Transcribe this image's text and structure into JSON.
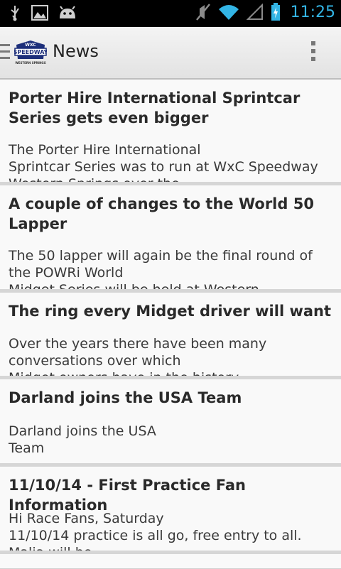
{
  "status_bar": {
    "time": "11:25",
    "icons": [
      "usb-icon",
      "image-icon",
      "android-icon",
      "mute-icon",
      "wifi-icon",
      "signal-icon",
      "battery-icon"
    ]
  },
  "action_bar": {
    "logo_text_top": "WXC",
    "logo_text_main": "SPEEDWAY",
    "logo_text_sub": "WESTERN SPRINGS",
    "title": "News"
  },
  "articles": [
    {
      "title": "Porter Hire International Sprintcar Series gets even bigger",
      "summary": "The Porter Hire International\nSprintcar Series was to run at WxC Speedway\nWestern Springs over the"
    },
    {
      "title": "A couple of changes to the World 50 Lapper",
      "summary": "The 50 lapper will again be the final round of the POWRi World\nMidget Series will be held at Western"
    },
    {
      "title": "The ring every Midget driver will want",
      "summary": "Over the years there have been many conversations over which\nMidget owners have in the history"
    },
    {
      "title": "Darland joins the USA Team",
      "summary": "Darland joins the USA\nTeam"
    },
    {
      "title": "11/10/14 - First Practice Fan Information",
      "summary": "Hi Race Fans, Saturday\n11/10/14 practice is all go, free entry to all.\nMalia will be"
    }
  ]
}
